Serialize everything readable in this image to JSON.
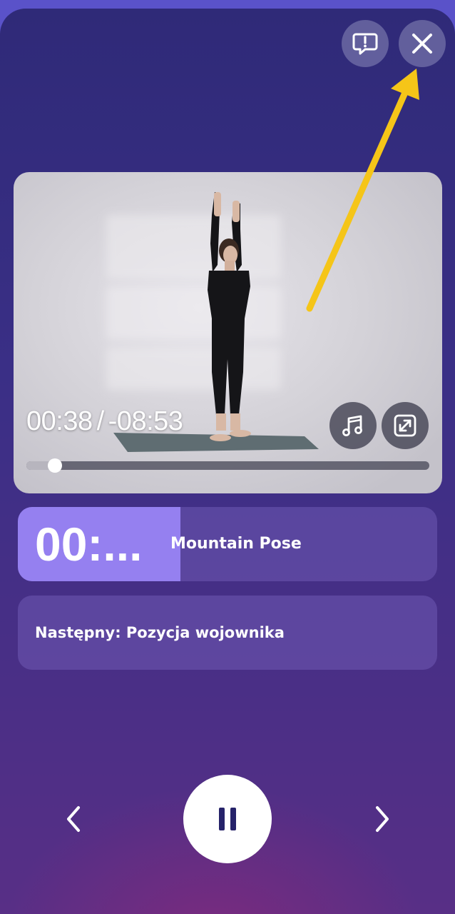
{
  "player": {
    "elapsed": "00:38",
    "separator": "/",
    "remaining": "-08:53",
    "progress_fraction": 0.07
  },
  "current_exercise": {
    "timer": "00:...",
    "name": "Mountain Pose"
  },
  "next_exercise": {
    "text": "Następny: Pozycja wojownika"
  },
  "icons": {
    "report": "feedback-exclamation-icon",
    "close": "close-icon",
    "music": "music-note-icon",
    "fullscreen": "expand-icon",
    "previous": "chevron-left-icon",
    "pause": "pause-icon",
    "next": "chevron-right-icon"
  },
  "colors": {
    "accent": "#9580f0",
    "annotation_arrow": "#f5c518"
  }
}
